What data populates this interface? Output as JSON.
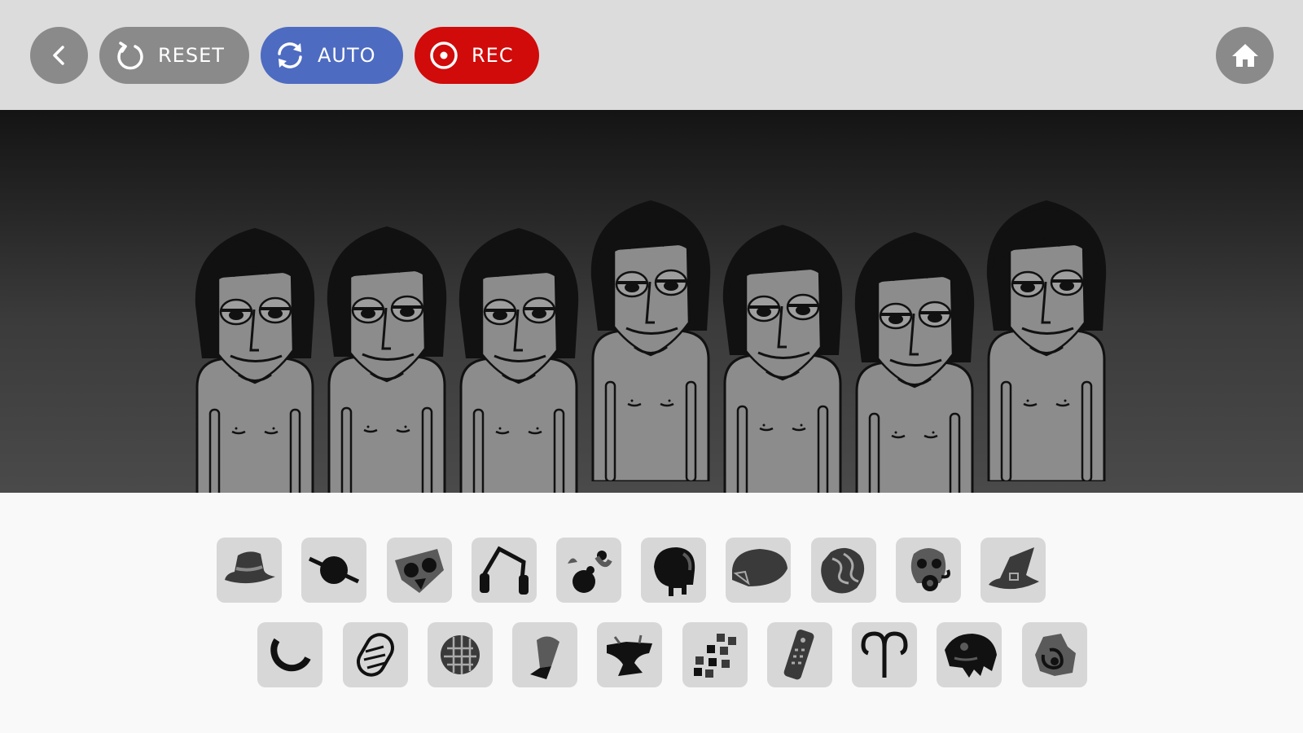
{
  "toolbar": {
    "reset_label": "RESET",
    "auto_label": "AUTO",
    "rec_label": "REC",
    "colors": {
      "bar": "#dcdcdc",
      "grey_button": "#8a8a8a",
      "auto": "#4d6bc1",
      "rec": "#d10a0a"
    }
  },
  "stage": {
    "character_count": 7
  },
  "sound_icons": {
    "row1": [
      "hat-icon",
      "disc-icon",
      "mask-icon",
      "headphones-icon",
      "bubbles-icon",
      "helmet-icon",
      "cap-icon",
      "brain-icon",
      "gas-mask-icon",
      "witch-hat-icon"
    ],
    "row2": [
      "ring-icon",
      "spring-icon",
      "grill-icon",
      "glove-icon",
      "anvil-icon",
      "blocks-icon",
      "remote-icon",
      "aries-icon",
      "beast-mask-icon",
      "rock-icon"
    ]
  }
}
